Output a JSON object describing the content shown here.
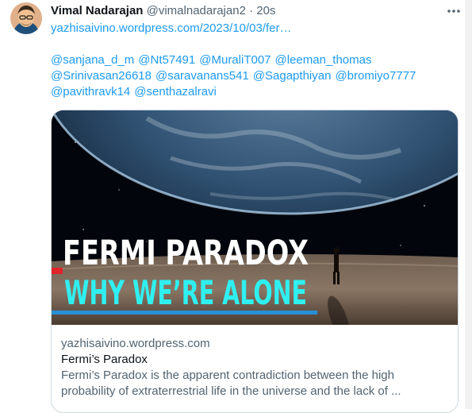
{
  "tweet": {
    "author_name": "Vimal Nadarajan",
    "author_handle": "@vimalnadarajan2",
    "separator": "·",
    "timestamp": "20s",
    "link": "yazhisaivino.wordpress.com/2023/10/03/fer…",
    "mentions": [
      "@sanjana_d_m",
      "@Nt57491",
      "@MuraliT007",
      "@leeman_thomas",
      "@Srinivasan26618",
      "@saravanans541",
      "@Sagapthiyan",
      "@bromiyo7777",
      "@pavithravk14",
      "@senthazalravi"
    ]
  },
  "card": {
    "image_title_line1": "FERMI PARADOX",
    "image_title_line2": "WHY WE’RE ALONE",
    "domain": "yazhisaivino.wordpress.com",
    "title": "Fermi’s Paradox",
    "description_line1": "Fermi’s Paradox is the apparent contradiction between the high",
    "description_line2": "probability of extraterrestrial life in the universe and the lack of ..."
  },
  "colors": {
    "link": "#1d9bf0",
    "text_primary": "#0f1419",
    "text_secondary": "#536471",
    "border": "#cfd9de",
    "headline_white": "#ffffff",
    "headline_cyan": "#2ff0f0"
  },
  "icons": {
    "more": "more-horizontal-icon",
    "avatar": "avatar"
  }
}
